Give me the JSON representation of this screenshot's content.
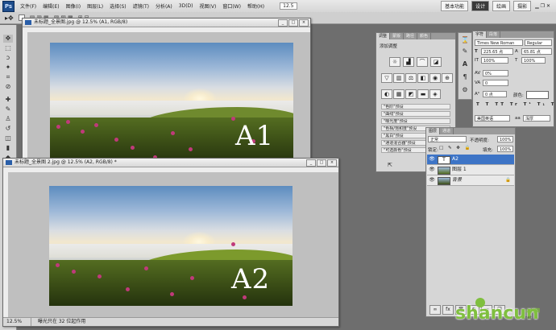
{
  "app": {
    "logo": "Ps",
    "menus": [
      "文件(F)",
      "编辑(E)",
      "图像(I)",
      "图层(L)",
      "选择(S)",
      "滤镜(T)",
      "分析(A)",
      "3D(D)",
      "视图(V)",
      "窗口(W)",
      "帮助(H)"
    ],
    "zoom": "12.5",
    "workspaces": [
      "基本功能",
      "设计",
      "绘画",
      "摄影"
    ],
    "active_workspace": "设计"
  },
  "doc1": {
    "title": "未标题_全景图.jpg @ 12.5% (A1, RGB/8)",
    "label": "A1"
  },
  "doc2": {
    "title": "未标题_全景图 2.jpg @ 12.5% (A2, RGB/8) *",
    "label": "A2",
    "zoom": "12.5%",
    "status": "曝光只在 32 位起作用"
  },
  "adjustments": {
    "tabs": [
      "调整",
      "蒙版",
      "路径",
      "颜色"
    ],
    "title": "添加调整",
    "presets": [
      "\"色阶\"预设",
      "\"曲线\"预设",
      "\"曝光度\"预设",
      "\"色相/饱和度\"预设",
      "\"黑白\"预设",
      "\"通道混合器\"预设",
      "\"可选颜色\"预设"
    ]
  },
  "character": {
    "tabs": [
      "字符",
      "段落"
    ],
    "font": "Times New Roman",
    "style": "Regular",
    "size": "225.65 点",
    "leading": "65.81 点",
    "scale_v": "100%",
    "scale_h": "100%",
    "tracking": "0%",
    "kern": "0",
    "baseline": "0 点",
    "color_label": "颜色:",
    "language": "美国英语",
    "aa": "浑厚"
  },
  "layers": {
    "tabs": [
      "图层",
      "通道"
    ],
    "blend": "正常",
    "opacity_label": "不透明度:",
    "opacity": "100%",
    "lock_label": "锁定:",
    "fill_label": "填充:",
    "fill": "100%",
    "items": [
      {
        "name": "A2",
        "selected": true,
        "type": "text"
      },
      {
        "name": "图层 1",
        "selected": false,
        "type": "image"
      },
      {
        "name": "背景",
        "selected": false,
        "type": "image"
      }
    ]
  },
  "watermark": {
    "brand": "shancun",
    "cn": "山村网",
    "url": ".net"
  }
}
